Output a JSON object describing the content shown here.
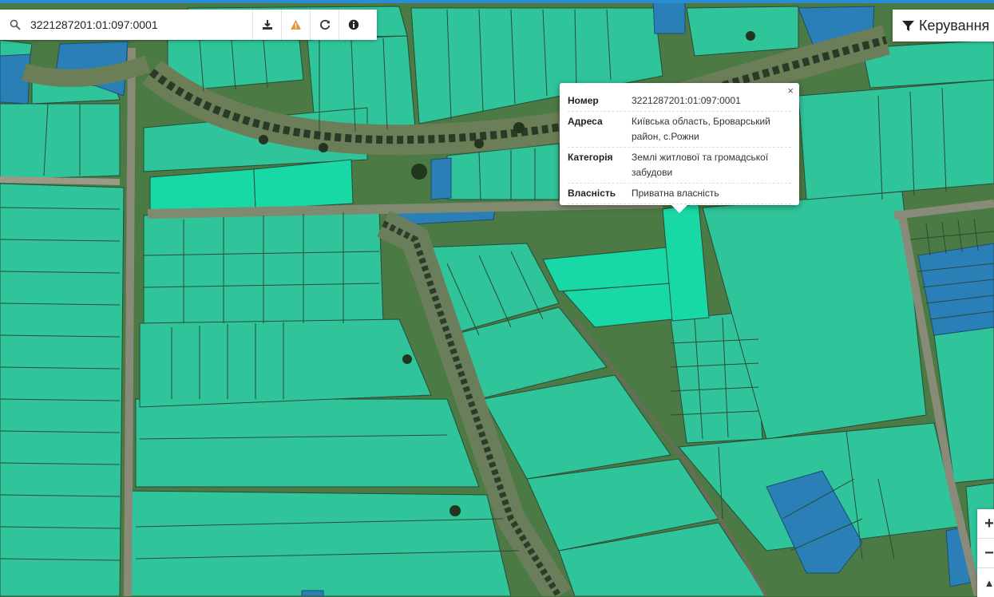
{
  "search": {
    "value": "3221287201:01:097:0001"
  },
  "toolbar": {
    "download_icon": "download-icon",
    "warning_icon": "warning-icon",
    "refresh_icon": "refresh-icon",
    "info_icon": "info-icon"
  },
  "manage": {
    "label": "Керування",
    "icon": "filter-icon"
  },
  "popup": {
    "close": "×",
    "rows": [
      {
        "key": "Номер",
        "value": "3221287201:01:097:0001"
      },
      {
        "key": "Адреса",
        "value": "Київська область, Броварський район, с.Рожни"
      },
      {
        "key": "Категорія",
        "value": "Землі житлової та громадської забудови"
      },
      {
        "key": "Власність",
        "value": "Приватна власність"
      }
    ]
  },
  "zoom": {
    "in": "+",
    "out": "−",
    "north": "▲"
  },
  "colors": {
    "parcel_green": "#2fc49a",
    "parcel_highlight": "#18d9a5",
    "parcel_blue": "#2a7fb6",
    "aerial_dark": "#3a5e35",
    "road": "#8a8a78"
  }
}
